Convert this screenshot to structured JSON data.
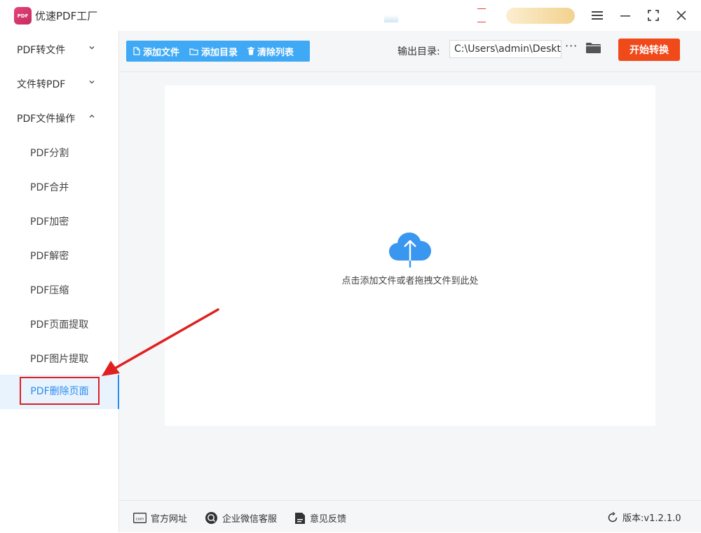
{
  "app": {
    "title": "优速PDF工厂",
    "logo_text": "PDF"
  },
  "sidebar": {
    "groups": [
      {
        "label": "PDF转文件",
        "expanded": false
      },
      {
        "label": "文件转PDF",
        "expanded": false
      },
      {
        "label": "PDF文件操作",
        "expanded": true
      }
    ],
    "items": [
      {
        "label": "PDF分割"
      },
      {
        "label": "PDF合并"
      },
      {
        "label": "PDF加密"
      },
      {
        "label": "PDF解密"
      },
      {
        "label": "PDF压缩"
      },
      {
        "label": "PDF页面提取"
      },
      {
        "label": "PDF图片提取"
      },
      {
        "label": "PDF删除页面",
        "active": true
      }
    ]
  },
  "toolbar": {
    "add_file": "添加文件",
    "add_dir": "添加目录",
    "clear_list": "清除列表",
    "output_label": "输出目录:",
    "output_path": "C:\\Users\\admin\\Desktop",
    "more": "···",
    "start": "开始转换"
  },
  "dropzone": {
    "text": "点击添加文件或者拖拽文件到此处"
  },
  "footer": {
    "website": "官方网址",
    "wechat": "企业微信客服",
    "feedback": "意见反馈",
    "version": "版本:v1.2.1.0"
  },
  "colors": {
    "accent": "#2d8cf0",
    "toolbar_blue": "#3fa9f5",
    "start_orange": "#f04a1b",
    "highlight_red": "#e02020"
  }
}
